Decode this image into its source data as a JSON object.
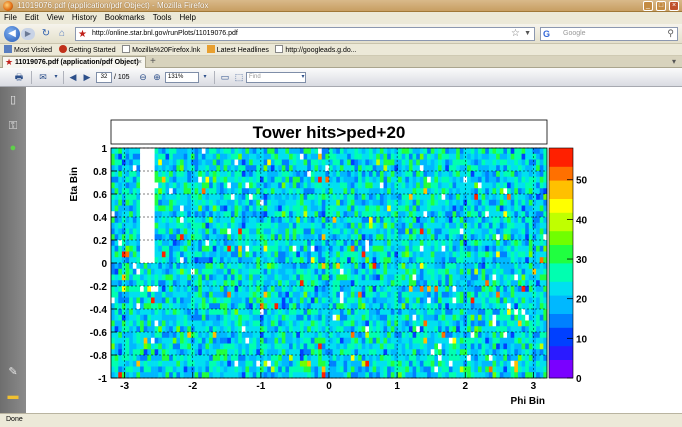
{
  "window": {
    "title": "11019076.pdf (application/pdf Object) - Mozilla Firefox"
  },
  "menu": [
    "File",
    "Edit",
    "View",
    "History",
    "Bookmarks",
    "Tools",
    "Help"
  ],
  "nav": {
    "url": "http://online.star.bnl.gov/runPlots/11019076.pdf",
    "search_placeholder": "Google",
    "search_engine": "G"
  },
  "bookmarks": [
    "Most Visited",
    "Getting Started",
    "Mozilla%20Firefox.lnk",
    "Latest Headlines",
    "http://googleads.g.do..."
  ],
  "tab": {
    "label": "11019076.pdf (application/pdf Object)"
  },
  "pdf_toolbar": {
    "page": "32",
    "page_total": "/ 105",
    "zoom": "131%",
    "find_placeholder": "Find"
  },
  "status": {
    "text": "Done"
  },
  "colors": {
    "titlebar": "#c79e62",
    "doc_background": "#ffffff",
    "left_pane": "#7a7a7a"
  },
  "chart_data": {
    "type": "heatmap",
    "title": "Tower hits>ped+20",
    "xlabel": "Phi Bin",
    "ylabel": "Eta Bin",
    "xlim": [
      -3.2,
      3.2
    ],
    "ylim": [
      -1,
      1
    ],
    "x_ticks": [
      "-3",
      "-2",
      "-1",
      "0",
      "1",
      "2",
      "3"
    ],
    "y_ticks": [
      "1",
      "0.8",
      "0.6",
      "0.4",
      "0.2",
      "0",
      "-0.2",
      "-0.4",
      "-0.6",
      "-0.8",
      "-1"
    ],
    "zlim": [
      0,
      58
    ],
    "z_ticks": [
      "0",
      "10",
      "20",
      "30",
      "40",
      "50"
    ],
    "grid": true,
    "n_phi_bins": 120,
    "n_eta_bins": 40,
    "typical_value": 22,
    "value_range_typical": [
      10,
      35
    ],
    "empty_region": {
      "phi": [
        -2.75,
        -2.55
      ],
      "eta": [
        0.0,
        1.0
      ]
    },
    "colormap": [
      "#7a00ff",
      "#2a1aff",
      "#0040ff",
      "#0080ff",
      "#00b8ff",
      "#00e0f0",
      "#00ffb0",
      "#20ff40",
      "#70ff00",
      "#c0ff00",
      "#ffff00",
      "#ffc000",
      "#ff7000",
      "#ff2000"
    ]
  }
}
